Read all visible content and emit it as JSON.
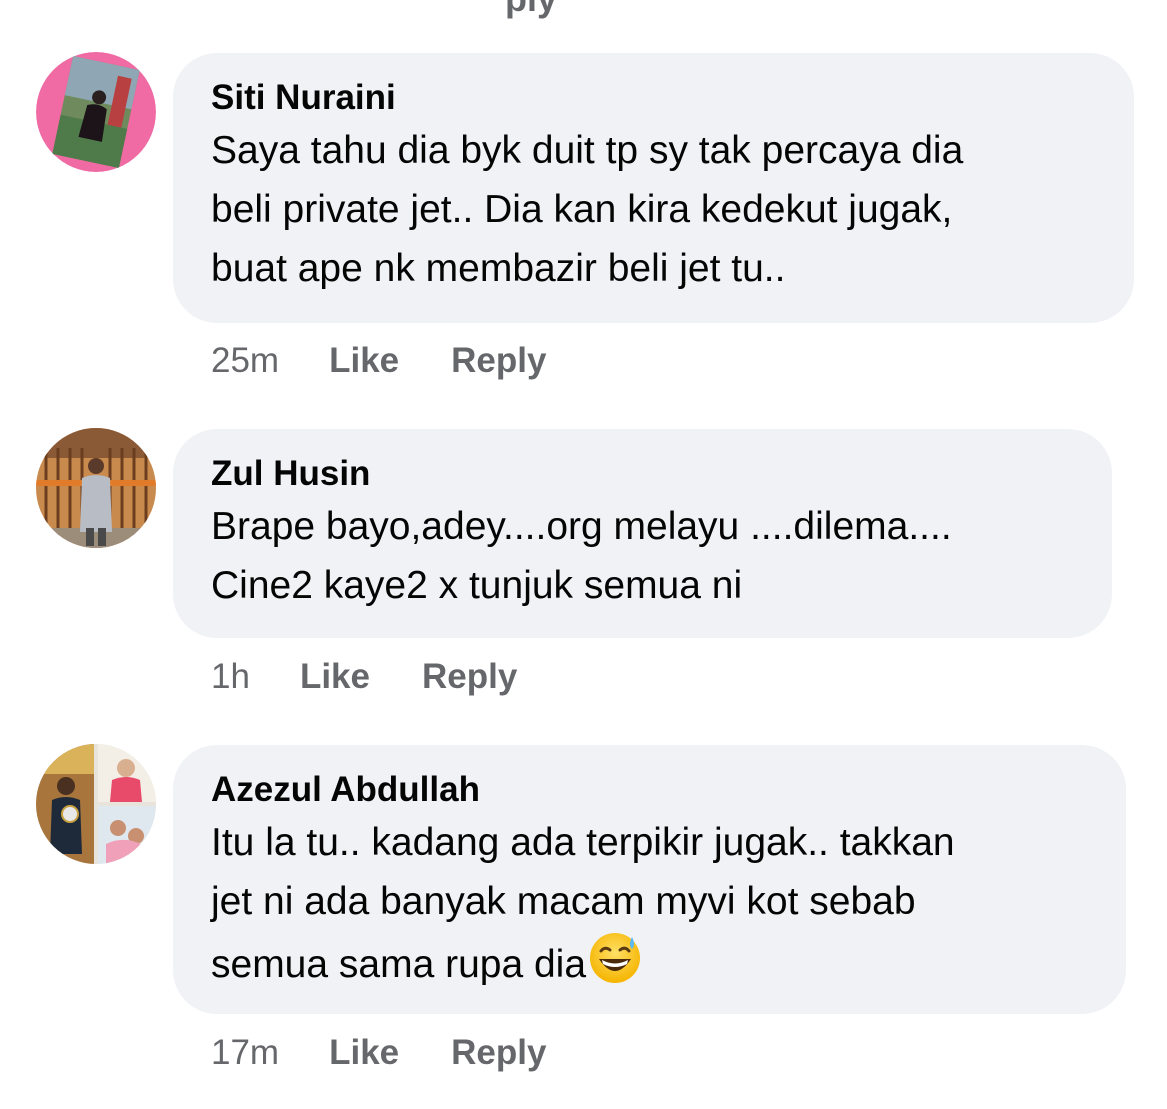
{
  "top_fragment": "ply",
  "comments": [
    {
      "author": "Siti Nuraini",
      "text": "Saya tahu dia byk duit tp sy tak percaya dia\nbeli private jet.. Dia kan kira kedekut jugak,\nbuat ape nk membazir beli jet tu..",
      "time": "25m",
      "like_label": "Like",
      "reply_label": "Reply",
      "avatar_icon": "profile-photo-pink-frame"
    },
    {
      "author": "Zul Husin",
      "text": "Brape bayo,adey....org melayu ....dilema....\nCine2 kaye2 x tunjuk semua ni",
      "time": "1h",
      "like_label": "Like",
      "reply_label": "Reply",
      "avatar_icon": "profile-photo-gate"
    },
    {
      "author": "Azezul Abdullah",
      "text": "Itu la tu.. kadang ada terpikir jugak.. takkan\njet ni ada banyak macam myvi kot sebab\nsemua sama rupa dia",
      "emoji": "grinning-face-with-sweat",
      "time": "17m",
      "like_label": "Like",
      "reply_label": "Reply",
      "avatar_icon": "profile-photo-collage"
    }
  ],
  "colors": {
    "bubble": "#f0f2f5",
    "text": "#050505",
    "secondary": "#65676b"
  }
}
